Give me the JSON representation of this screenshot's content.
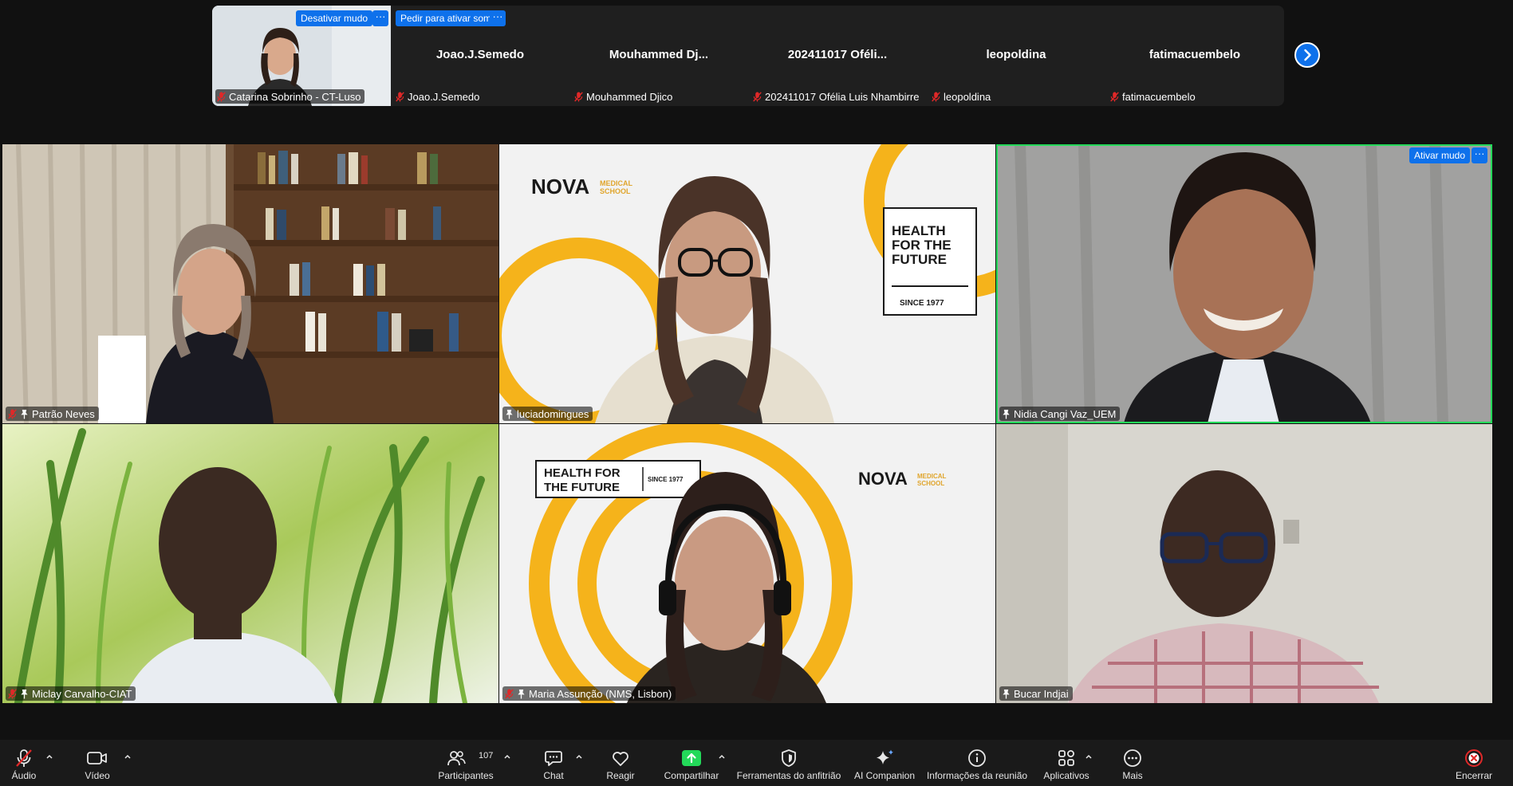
{
  "strip": {
    "self": {
      "name": "Catarina Sobrinho - CT-Luso",
      "unmute_button": "Desativar mudo"
    },
    "ask_unmute_button": "Pedir para ativar som",
    "participants": [
      {
        "display": "Joao.J.Semedo",
        "label": "Joao.J.Semedo"
      },
      {
        "display": "Mouhammed  Dj...",
        "label": "Mouhammed Djico"
      },
      {
        "display": "202411017 Oféli...",
        "label": "202411017 Ofélia Luis Nhambirre"
      },
      {
        "display": "leopoldina",
        "label": "leopoldina"
      },
      {
        "display": "fatimacuembelo",
        "label": "fatimacuembelo"
      }
    ]
  },
  "gallery": {
    "tiles": [
      {
        "name": "Patrão Neves"
      },
      {
        "name": "luciadomingues"
      },
      {
        "name": "Nidia Cangi Vaz_UEM"
      },
      {
        "name": "Miclay Carvalho-CIAT"
      },
      {
        "name": "Maria Assunção (NMS, Lisbon)"
      },
      {
        "name": "Bucar Indjai"
      }
    ],
    "active_unmute": "Ativar mudo",
    "nova": {
      "brand": "NOVA",
      "sub1": "MEDICAL",
      "sub2": "SCHOOL",
      "health1": "HEALTH",
      "health2": "FOR THE",
      "health3": "FUTURE",
      "since": "SINCE 1977",
      "banner1": "HEALTH FOR",
      "banner2": "THE FUTURE",
      "banner_since": "SINCE 1977"
    }
  },
  "toolbar": {
    "audio": "Áudio",
    "video": "Vídeo",
    "participants": "Participantes",
    "participants_count": "107",
    "chat": "Chat",
    "react": "Reagir",
    "share": "Compartilhar",
    "host_tools": "Ferramentas do anfitrião",
    "ai": "AI Companion",
    "info": "Informações da reunião",
    "apps": "Aplicativos",
    "more": "Mais",
    "end": "Encerrar"
  },
  "colors": {
    "accent": "#0e71eb",
    "active_speaker": "#23d959",
    "muted": "#e02828",
    "share_green": "#23d959",
    "nova_yellow": "#f5b31b"
  }
}
